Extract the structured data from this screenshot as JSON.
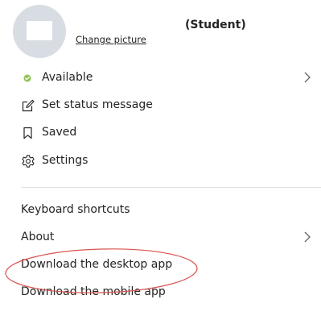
{
  "profile": {
    "display_name": "(Student)",
    "change_picture_label": "Change picture"
  },
  "status_menu": [
    {
      "label": "Available",
      "icon": "available-status-dot-icon",
      "has_submenu": true
    },
    {
      "label": "Set status message",
      "icon": "edit-status-icon",
      "has_submenu": false
    },
    {
      "label": "Saved",
      "icon": "bookmark-icon",
      "has_submenu": false
    },
    {
      "label": "Settings",
      "icon": "gear-icon",
      "has_submenu": false
    }
  ],
  "app_menu": [
    {
      "label": "Keyboard shortcuts",
      "has_submenu": false
    },
    {
      "label": "About",
      "has_submenu": true
    },
    {
      "label": "Download the desktop app",
      "has_submenu": false
    },
    {
      "label": "Download the mobile app",
      "has_submenu": false
    }
  ],
  "colors": {
    "available_green": "#92c353",
    "annotation_red": "#d9534f",
    "text": "#252423",
    "divider": "#e1dfdd"
  }
}
